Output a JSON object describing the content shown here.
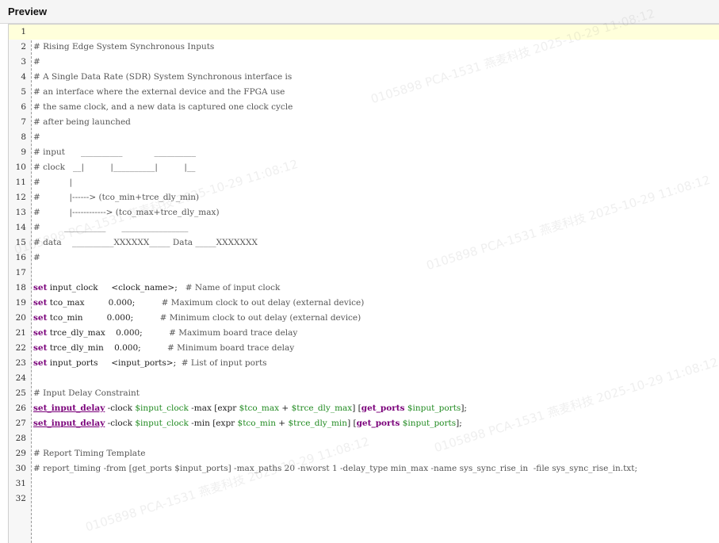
{
  "panel": {
    "title": "Preview"
  },
  "watermark": {
    "text": "0105898  PCA-1531  燕麦科技  2025-10-29  11:08:12"
  },
  "colors": {
    "keyword": "#7a007a",
    "variable": "#228b22",
    "comment": "#555555",
    "current_line": "#ffffdb"
  },
  "lines": [
    {
      "n": "1",
      "tokens": []
    },
    {
      "n": "2",
      "tokens": [
        {
          "t": "# Rising Edge System Synchronous Inputs",
          "c": "cmt"
        }
      ]
    },
    {
      "n": "3",
      "tokens": [
        {
          "t": "#",
          "c": "cmt"
        }
      ]
    },
    {
      "n": "4",
      "tokens": [
        {
          "t": "# A Single Data Rate (SDR) System Synchronous interface is",
          "c": "cmt"
        }
      ]
    },
    {
      "n": "5",
      "tokens": [
        {
          "t": "# an interface where the external device and the FPGA use",
          "c": "cmt"
        }
      ]
    },
    {
      "n": "6",
      "tokens": [
        {
          "t": "# the same clock, and a new data is captured one clock cycle",
          "c": "cmt"
        }
      ]
    },
    {
      "n": "7",
      "tokens": [
        {
          "t": "# after being launched",
          "c": "cmt"
        }
      ]
    },
    {
      "n": "8",
      "tokens": [
        {
          "t": "#",
          "c": "cmt"
        }
      ]
    },
    {
      "n": "9",
      "tokens": [
        {
          "t": "# input      __________            __________",
          "c": "cmt"
        }
      ]
    },
    {
      "n": "10",
      "tokens": [
        {
          "t": "# clock   __|          |__________|          |__",
          "c": "cmt"
        }
      ]
    },
    {
      "n": "11",
      "tokens": [
        {
          "t": "#           |",
          "c": "cmt"
        }
      ]
    },
    {
      "n": "12",
      "tokens": [
        {
          "t": "#           |------> (tco_min+trce_dly_min)",
          "c": "cmt"
        }
      ]
    },
    {
      "n": "13",
      "tokens": [
        {
          "t": "#           |------------> (tco_max+trce_dly_max)",
          "c": "cmt"
        }
      ]
    },
    {
      "n": "14",
      "tokens": [
        {
          "t": "#         __________      ________________",
          "c": "cmt"
        }
      ]
    },
    {
      "n": "15",
      "tokens": [
        {
          "t": "# data    __________XXXXXX_____ Data _____XXXXXXX",
          "c": "cmt"
        }
      ]
    },
    {
      "n": "16",
      "tokens": [
        {
          "t": "#",
          "c": "cmt"
        }
      ]
    },
    {
      "n": "17",
      "tokens": []
    },
    {
      "n": "18",
      "tokens": [
        {
          "t": "set",
          "c": "kw"
        },
        {
          "t": " input_clock     <clock_name>;   ",
          "c": "plain"
        },
        {
          "t": "# Name of input clock",
          "c": "cmt"
        }
      ]
    },
    {
      "n": "19",
      "tokens": [
        {
          "t": "set",
          "c": "kw"
        },
        {
          "t": " tco_max         0.000;          ",
          "c": "plain"
        },
        {
          "t": "# Maximum clock to out delay (external device)",
          "c": "cmt"
        }
      ]
    },
    {
      "n": "20",
      "tokens": [
        {
          "t": "set",
          "c": "kw"
        },
        {
          "t": " tco_min         0.000;          ",
          "c": "plain"
        },
        {
          "t": "# Minimum clock to out delay (external device)",
          "c": "cmt"
        }
      ]
    },
    {
      "n": "21",
      "tokens": [
        {
          "t": "set",
          "c": "kw"
        },
        {
          "t": " trce_dly_max    0.000;          ",
          "c": "plain"
        },
        {
          "t": "# Maximum board trace delay",
          "c": "cmt"
        }
      ]
    },
    {
      "n": "22",
      "tokens": [
        {
          "t": "set",
          "c": "kw"
        },
        {
          "t": " trce_dly_min    0.000;          ",
          "c": "plain"
        },
        {
          "t": "# Minimum board trace delay",
          "c": "cmt"
        }
      ]
    },
    {
      "n": "23",
      "tokens": [
        {
          "t": "set",
          "c": "kw"
        },
        {
          "t": " input_ports     <input_ports>;  ",
          "c": "plain"
        },
        {
          "t": "# List of input ports",
          "c": "cmt"
        }
      ]
    },
    {
      "n": "24",
      "tokens": []
    },
    {
      "n": "25",
      "tokens": [
        {
          "t": "# Input Delay Constraint",
          "c": "cmt"
        }
      ]
    },
    {
      "n": "26",
      "tokens": [
        {
          "t": "set_input_delay",
          "c": "kw2"
        },
        {
          "t": " -clock ",
          "c": "plain"
        },
        {
          "t": "$input_clock",
          "c": "var"
        },
        {
          "t": " -max [expr ",
          "c": "plain"
        },
        {
          "t": "$tco_max",
          "c": "var"
        },
        {
          "t": " + ",
          "c": "plain"
        },
        {
          "t": "$trce_dly_max",
          "c": "var"
        },
        {
          "t": "] [",
          "c": "plain"
        },
        {
          "t": "get_ports",
          "c": "kw"
        },
        {
          "t": " ",
          "c": "plain"
        },
        {
          "t": "$input_ports",
          "c": "var"
        },
        {
          "t": "];",
          "c": "plain"
        }
      ]
    },
    {
      "n": "27",
      "tokens": [
        {
          "t": "set_input_delay",
          "c": "kw2"
        },
        {
          "t": " -clock ",
          "c": "plain"
        },
        {
          "t": "$input_clock",
          "c": "var"
        },
        {
          "t": " -min [expr ",
          "c": "plain"
        },
        {
          "t": "$tco_min",
          "c": "var"
        },
        {
          "t": " + ",
          "c": "plain"
        },
        {
          "t": "$trce_dly_min",
          "c": "var"
        },
        {
          "t": "] [",
          "c": "plain"
        },
        {
          "t": "get_ports",
          "c": "kw"
        },
        {
          "t": " ",
          "c": "plain"
        },
        {
          "t": "$input_ports",
          "c": "var"
        },
        {
          "t": "];",
          "c": "plain"
        }
      ]
    },
    {
      "n": "28",
      "tokens": []
    },
    {
      "n": "29",
      "tokens": [
        {
          "t": "# Report Timing Template",
          "c": "cmt"
        }
      ]
    },
    {
      "n": "30",
      "tokens": [
        {
          "t": "# report_timing -from [get_ports $input_ports] -max_paths 20 -nworst 1 -delay_type min_max -name sys_sync_rise_in  -file sys_sync_rise_in.txt;",
          "c": "cmt"
        }
      ]
    },
    {
      "n": "31",
      "tokens": []
    },
    {
      "n": "32",
      "tokens": []
    }
  ],
  "scrollbar": {
    "left_arrow": "‹"
  }
}
